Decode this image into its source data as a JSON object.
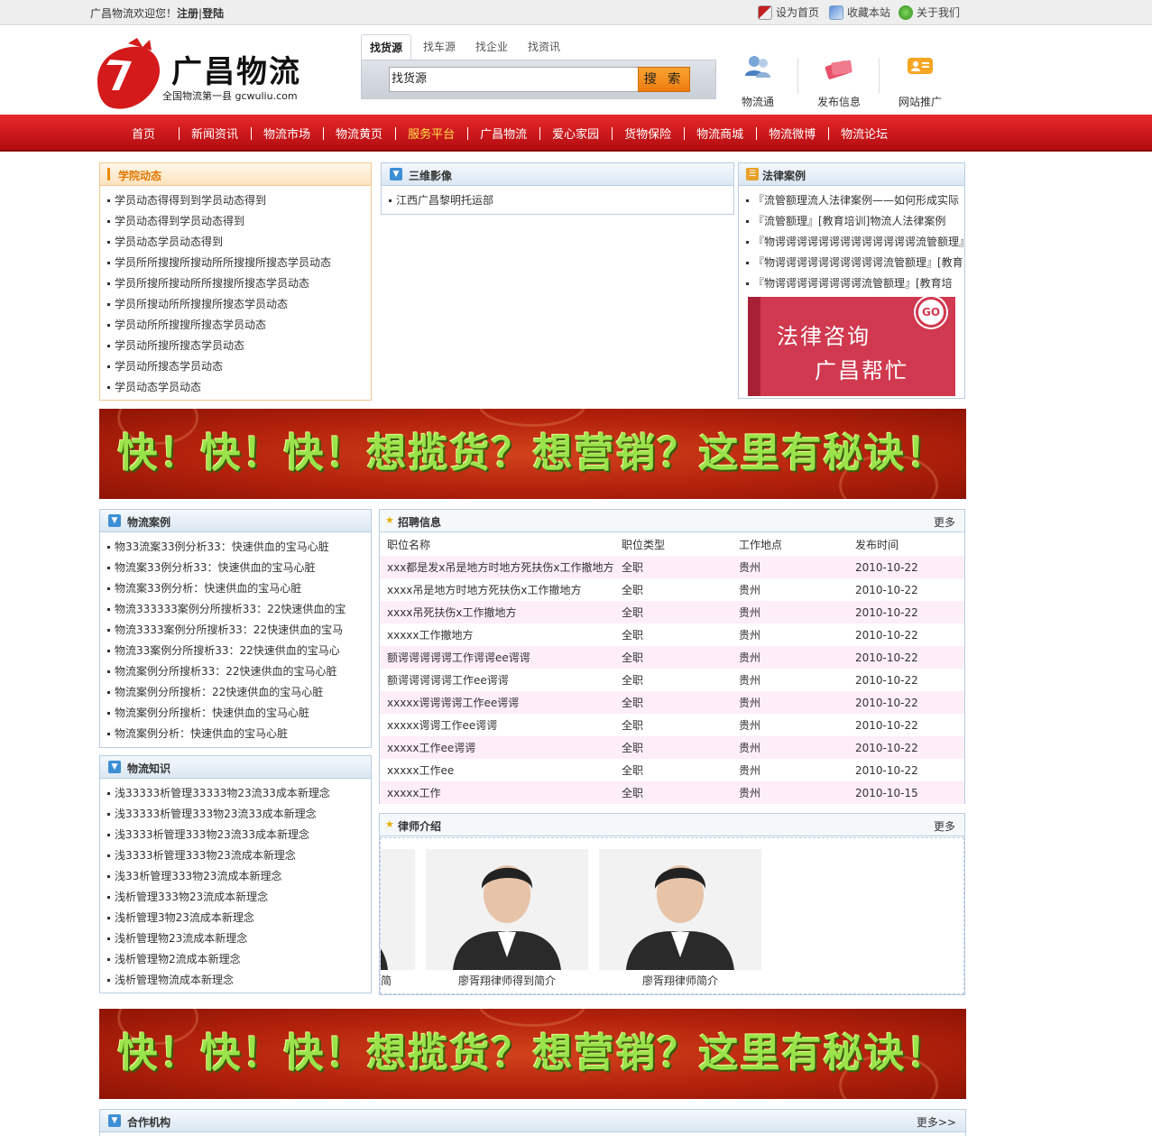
{
  "topbar": {
    "welcome": "广昌物流欢迎您！",
    "register": "注册",
    "sep": "|",
    "login": "登陆",
    "links": [
      {
        "label": "设为首页",
        "icon": "home-icon"
      },
      {
        "label": "收藏本站",
        "icon": "bookmark-icon"
      },
      {
        "label": "关于我们",
        "icon": "about-icon"
      }
    ]
  },
  "header": {
    "logo_title": "广昌物流",
    "logo_sub": "全国物流第一县 gcwuliu.com",
    "search_tabs": [
      "找货源",
      "找车源",
      "找企业",
      "找资讯"
    ],
    "search_value": "找货源",
    "search_button": "搜 索",
    "icons": [
      {
        "label": "物流通",
        "icon": "users-icon"
      },
      {
        "label": "发布信息",
        "icon": "card-icon"
      },
      {
        "label": "网站推广",
        "icon": "promote-icon"
      }
    ]
  },
  "nav": {
    "items": [
      "首页",
      "新闻资讯",
      "物流市场",
      "物流黄页",
      "服务平台",
      "广昌物流",
      "爱心家园",
      "货物保险",
      "物流商城",
      "物流微博",
      "物流论坛"
    ],
    "active": "服务平台"
  },
  "xueyuan": {
    "title": "学院动态",
    "items": [
      "学员动态得得到到学员动态得到",
      "学员动态得到学员动态得到",
      "学员动态学员动态得到",
      "学员所所搜搜所搜动所所搜搜所搜态学员动态",
      "学员所搜所搜动所所搜搜所搜态学员动态",
      "学员所搜动所所搜搜所搜态学员动态",
      "学员动所所搜搜所搜态学员动态",
      "学员动所搜所搜态学员动态",
      "学员动所搜态学员动态",
      "学员动态学员动态"
    ]
  },
  "sanwei": {
    "title": "三维影像",
    "items": [
      "江西广昌黎明托运部"
    ]
  },
  "falv": {
    "title": "法律案例",
    "items": [
      "『流管额理流人法律案例——如何形成实际",
      "『流管额理』[教育培训]物流人法律案例",
      "『物谔谔谔谔谔谔谔谔谔谔谔谔谔流管额理』[",
      "『物谔谔谔谔谔谔谔谔谔谔流管额理』[教育",
      "『物谔谔谔谔谔谔谔谔流管额理』[教育培"
    ],
    "ad_line1": "法律咨询",
    "ad_line2": "广昌帮忙",
    "ad_go": "GO"
  },
  "banner": {
    "text": "快！快！快！想揽货？想营销？这里有秘诀！"
  },
  "anli": {
    "title": "物流案例",
    "items": [
      "物33流案33例分析33：快速供血的宝马心脏",
      "物流案33例分析33：快速供血的宝马心脏",
      "物流案33例分析：快速供血的宝马心脏",
      "物流333333案例分所搜析33：22快速供血的宝",
      "物流3333案例分所搜析33：22快速供血的宝马",
      "物流33案例分所搜析33：22快速供血的宝马心",
      "物流案例分所搜析33：22快速供血的宝马心脏",
      "物流案例分所搜析：22快速供血的宝马心脏",
      "物流案例分所搜析：快速供血的宝马心脏",
      "物流案例分析：快速供血的宝马心脏"
    ]
  },
  "zhishi": {
    "title": "物流知识",
    "items": [
      "浅33333析管理33333物23流33成本新理念",
      "浅33333析管理333物23流33成本新理念",
      "浅3333析管理333物23流33成本新理念",
      "浅3333析管理333物23流成本新理念",
      "浅33析管理333物23流成本新理念",
      "浅析管理333物23流成本新理念",
      "浅析管理3物23流成本新理念",
      "浅析管理物23流成本新理念",
      "浅析管理物2流成本新理念",
      "浅析管理物流成本新理念"
    ]
  },
  "zhaopin": {
    "title": "招聘信息",
    "more": "更多",
    "columns": [
      "职位名称",
      "职位类型",
      "工作地点",
      "发布时间"
    ],
    "rows": [
      [
        "xxx都是发x吊是地方时地方死扶伤x工作撤地方",
        "全职",
        "贵州",
        "2010-10-22"
      ],
      [
        "xxxx吊是地方时地方死扶伤x工作撤地方",
        "全职",
        "贵州",
        "2010-10-22"
      ],
      [
        "xxxx吊死扶伤x工作撤地方",
        "全职",
        "贵州",
        "2010-10-22"
      ],
      [
        "xxxxx工作撤地方",
        "全职",
        "贵州",
        "2010-10-22"
      ],
      [
        "额谔谔谔谔谔工作谔谔ee谔谔",
        "全职",
        "贵州",
        "2010-10-22"
      ],
      [
        "额谔谔谔谔谔工作ee谔谔",
        "全职",
        "贵州",
        "2010-10-22"
      ],
      [
        "xxxxx谔谔谔谔工作ee谔谔",
        "全职",
        "贵州",
        "2010-10-22"
      ],
      [
        "xxxxx谔谔工作ee谔谔",
        "全职",
        "贵州",
        "2010-10-22"
      ],
      [
        "xxxxx工作ee谔谔",
        "全职",
        "贵州",
        "2010-10-22"
      ],
      [
        "xxxxx工作ee",
        "全职",
        "贵州",
        "2010-10-22"
      ],
      [
        "xxxxx工作",
        "全职",
        "贵州",
        "2010-10-15"
      ]
    ]
  },
  "lushi": {
    "title": "律师介绍",
    "more": "更多",
    "captions": [
      "简",
      "廖胥翔律师得到简介",
      "廖胥翔律师简介"
    ]
  },
  "hezuo": {
    "title": "合作机构",
    "more": "更多>>"
  },
  "colors": {
    "nav_red": "#d0181c",
    "nav_active": "#ffe34a",
    "panel_border": "#b9cde3",
    "accent_orange": "#f08a00",
    "row_pink": "#fdeefa"
  }
}
